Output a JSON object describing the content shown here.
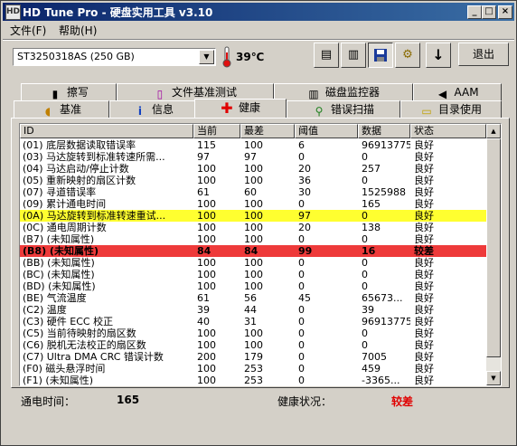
{
  "window": {
    "title": "HD Tune Pro - 硬盘实用工具 v3.10",
    "icon": "hdd-app-icon",
    "controls": [
      "_",
      "□",
      "×"
    ]
  },
  "menu": [
    "文件(F)",
    "帮助(H)"
  ],
  "toolbar": {
    "drive": "ST3250318AS (250 GB)",
    "temperature": "39℃",
    "buttons": [
      {
        "name": "copy-text-icon",
        "glyph": "▤"
      },
      {
        "name": "copy-screen-icon",
        "glyph": "▥"
      },
      {
        "name": "save-disk-icon",
        "glyph": "💾"
      },
      {
        "name": "options-icon",
        "glyph": "⚙"
      },
      {
        "name": "download-arrow-icon",
        "glyph": "↓"
      }
    ],
    "exit": "退出"
  },
  "tabs_row1": [
    {
      "label": "擦写",
      "icon": "erase-icon"
    },
    {
      "label": "文件基准测试",
      "icon": "file-benchmark-icon"
    },
    {
      "label": "磁盘监控器",
      "icon": "disk-monitor-icon"
    },
    {
      "label": "AAM",
      "icon": "speaker-icon"
    }
  ],
  "tabs_row2": [
    {
      "label": "基准",
      "icon": "benchmark-icon"
    },
    {
      "label": "信息",
      "icon": "info-icon"
    },
    {
      "label": "健康",
      "icon": "health-cross-icon",
      "active": true
    },
    {
      "label": "错误扫描",
      "icon": "magnifier-icon"
    },
    {
      "label": "目录使用",
      "icon": "folder-icon"
    }
  ],
  "columns": [
    "ID",
    "当前",
    "最差",
    "阈值",
    "数据",
    "状态"
  ],
  "rows": [
    {
      "id": "(01) 底层数据读取错误率",
      "cur": "115",
      "worst": "100",
      "thr": "6",
      "data": "96913775",
      "status": "良好"
    },
    {
      "id": "(03) 马达旋转到标准转速所需...",
      "cur": "97",
      "worst": "97",
      "thr": "0",
      "data": "0",
      "status": "良好"
    },
    {
      "id": "(04) 马达启动/停止计数",
      "cur": "100",
      "worst": "100",
      "thr": "20",
      "data": "257",
      "status": "良好"
    },
    {
      "id": "(05) 重新映射的扇区计数",
      "cur": "100",
      "worst": "100",
      "thr": "36",
      "data": "0",
      "status": "良好"
    },
    {
      "id": "(07) 寻道错误率",
      "cur": "61",
      "worst": "60",
      "thr": "30",
      "data": "1525988",
      "status": "良好"
    },
    {
      "id": "(09) 累计通电时间",
      "cur": "100",
      "worst": "100",
      "thr": "0",
      "data": "165",
      "status": "良好"
    },
    {
      "id": "(0A) 马达旋转到标准转速重试...",
      "cur": "100",
      "worst": "100",
      "thr": "97",
      "data": "0",
      "status": "良好",
      "hl": "yellow"
    },
    {
      "id": "(0C) 通电周期计数",
      "cur": "100",
      "worst": "100",
      "thr": "20",
      "data": "138",
      "status": "良好"
    },
    {
      "id": "(B7) (未知属性)",
      "cur": "100",
      "worst": "100",
      "thr": "0",
      "data": "0",
      "status": "良好"
    },
    {
      "id": "(B8) (未知属性)",
      "cur": "84",
      "worst": "84",
      "thr": "99",
      "data": "16",
      "status": "较差",
      "hl": "red"
    },
    {
      "id": "(BB) (未知属性)",
      "cur": "100",
      "worst": "100",
      "thr": "0",
      "data": "0",
      "status": "良好"
    },
    {
      "id": "(BC) (未知属性)",
      "cur": "100",
      "worst": "100",
      "thr": "0",
      "data": "0",
      "status": "良好"
    },
    {
      "id": "(BD) (未知属性)",
      "cur": "100",
      "worst": "100",
      "thr": "0",
      "data": "0",
      "status": "良好"
    },
    {
      "id": "(BE) 气流温度",
      "cur": "61",
      "worst": "56",
      "thr": "45",
      "data": "65673...",
      "status": "良好"
    },
    {
      "id": "(C2) 温度",
      "cur": "39",
      "worst": "44",
      "thr": "0",
      "data": "39",
      "status": "良好"
    },
    {
      "id": "(C3) 硬件 ECC 校正",
      "cur": "40",
      "worst": "31",
      "thr": "0",
      "data": "96913775",
      "status": "良好"
    },
    {
      "id": "(C5) 当前待映射的扇区数",
      "cur": "100",
      "worst": "100",
      "thr": "0",
      "data": "0",
      "status": "良好"
    },
    {
      "id": "(C6) 脱机无法校正的扇区数",
      "cur": "100",
      "worst": "100",
      "thr": "0",
      "data": "0",
      "status": "良好"
    },
    {
      "id": "(C7) Ultra DMA CRC 错误计数",
      "cur": "200",
      "worst": "179",
      "thr": "0",
      "data": "7005",
      "status": "良好"
    },
    {
      "id": "(F0) 磁头悬浮时间",
      "cur": "100",
      "worst": "253",
      "thr": "0",
      "data": "459",
      "status": "良好"
    },
    {
      "id": "(F1) (未知属性)",
      "cur": "100",
      "worst": "253",
      "thr": "0",
      "data": "-3365...",
      "status": "良好"
    }
  ],
  "status": {
    "power_on_label": "通电时间：",
    "power_on_value": "165",
    "health_label": "健康状况：",
    "health_value": "较差",
    "health_color": "#e00000"
  }
}
